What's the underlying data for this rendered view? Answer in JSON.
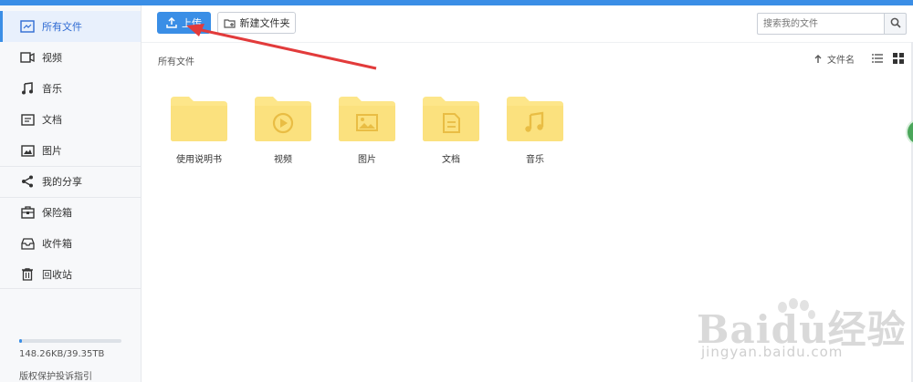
{
  "colors": {
    "accent": "#3a8ee6",
    "folder": "#fde68a",
    "folder_dark": "#f6d66b",
    "folder_icon": "#e9bd44"
  },
  "sidebar": {
    "items": [
      {
        "label": "所有文件",
        "icon": "all-files-icon",
        "active": true
      },
      {
        "label": "视频",
        "icon": "video-icon",
        "active": false
      },
      {
        "label": "音乐",
        "icon": "music-icon",
        "active": false
      },
      {
        "label": "文档",
        "icon": "document-icon",
        "active": false
      },
      {
        "label": "图片",
        "icon": "image-icon",
        "active": false
      },
      {
        "label": "我的分享",
        "icon": "share-icon",
        "active": false
      },
      {
        "label": "保险箱",
        "icon": "safe-icon",
        "active": false
      },
      {
        "label": "收件箱",
        "icon": "inbox-icon",
        "active": false
      },
      {
        "label": "回收站",
        "icon": "trash-icon",
        "active": false
      }
    ],
    "storage": {
      "text": "148.26KB/39.35TB",
      "used_fraction": 0.03
    },
    "footer_link": "版权保护投诉指引"
  },
  "toolbar": {
    "upload_label": "上传",
    "new_folder_label": "新建文件夹",
    "search_placeholder": "搜索我的文件"
  },
  "main": {
    "breadcrumb": "所有文件",
    "sort_label": "文件名",
    "folders": [
      {
        "name": "使用说明书",
        "icon": "plain-folder-icon"
      },
      {
        "name": "视频",
        "icon": "video-folder-icon"
      },
      {
        "name": "图片",
        "icon": "image-folder-icon"
      },
      {
        "name": "文档",
        "icon": "document-folder-icon"
      },
      {
        "name": "音乐",
        "icon": "music-folder-icon"
      }
    ]
  },
  "watermark": {
    "text": "Baidu经验",
    "sub": "jingyan.baidu.com"
  }
}
